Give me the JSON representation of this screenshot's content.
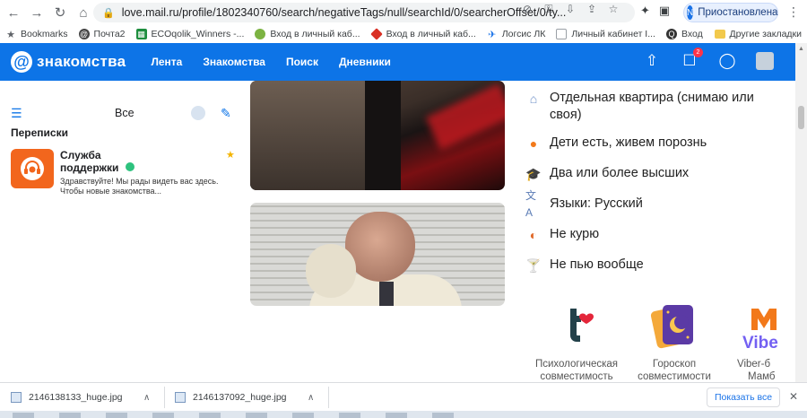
{
  "browser": {
    "url": "love.mail.ru/profile/1802340760/search/negativeTags/null/searchId/0/searcherOffset/0/ty...",
    "profile_initial": "N",
    "profile_status": "Приостановлена",
    "bookmarks": [
      {
        "label": "Bookmarks",
        "icon": "star-icon",
        "color": "#5f6368"
      },
      {
        "label": "Почта2",
        "icon": "mail-icon",
        "color": "#444"
      },
      {
        "label": "ECOqolik_Winners -...",
        "icon": "sheets-icon",
        "color": "#1e8e3e"
      },
      {
        "label": "Вход в личный каб...",
        "icon": "leaf-icon",
        "color": "#7cb342"
      },
      {
        "label": "Вход в личный каб...",
        "icon": "diamond-icon",
        "color": "#d93025"
      },
      {
        "label": "Логсис ЛК",
        "icon": "plane-icon",
        "color": "#1a73e8"
      },
      {
        "label": "Личный кабинет I...",
        "icon": "doc-icon",
        "color": "#9aa0a6"
      },
      {
        "label": "Вход",
        "icon": "circle-logo-icon",
        "color": "#333"
      }
    ],
    "other_bookmarks": "Другие закладки"
  },
  "site": {
    "logo_text": "знакомства",
    "nav": [
      "Лента",
      "Знакомства",
      "Поиск",
      "Дневники"
    ],
    "notification_count": "2",
    "accent": "#0d74e7"
  },
  "messages": {
    "filter_label": "Все",
    "section_title": "Переписки",
    "chat": {
      "name": "Служба поддержки",
      "preview": "Здравствуйте! Мы рады видеть вас здесь. Чтобы новые знакомства..."
    }
  },
  "profile_details": [
    {
      "icon": "house-icon",
      "text": "Отдельная квартира (снимаю или своя)",
      "color": "#6c8fc7"
    },
    {
      "icon": "pacifier-icon",
      "text": "Дети есть, живем порознь",
      "color": "#f2791b"
    },
    {
      "icon": "graduation-cap-icon",
      "text": "Два или более высших",
      "color": "#2b3340"
    },
    {
      "icon": "language-icon",
      "text": "Языки: Русский",
      "color": "#5a7bb5"
    },
    {
      "icon": "pipe-icon",
      "text": "Не курю",
      "color": "#e06a2a"
    },
    {
      "icon": "cocktail-icon",
      "text": "Не пью вообще",
      "color": "#2ec27e"
    }
  ],
  "promo_apps": [
    {
      "icon": "compatibility-icon",
      "caption_1": "Психологическая",
      "caption_2": "совместимость"
    },
    {
      "icon": "horoscope-icon",
      "caption_1": "Гороскоп",
      "caption_2": "совместимости"
    },
    {
      "icon": "viber-icon",
      "caption_1": "Viber-б",
      "caption_2": "Мамб"
    }
  ],
  "downloads": {
    "items": [
      "2146138133_huge.jpg",
      "2146137092_huge.jpg"
    ],
    "show_all": "Показать все"
  }
}
